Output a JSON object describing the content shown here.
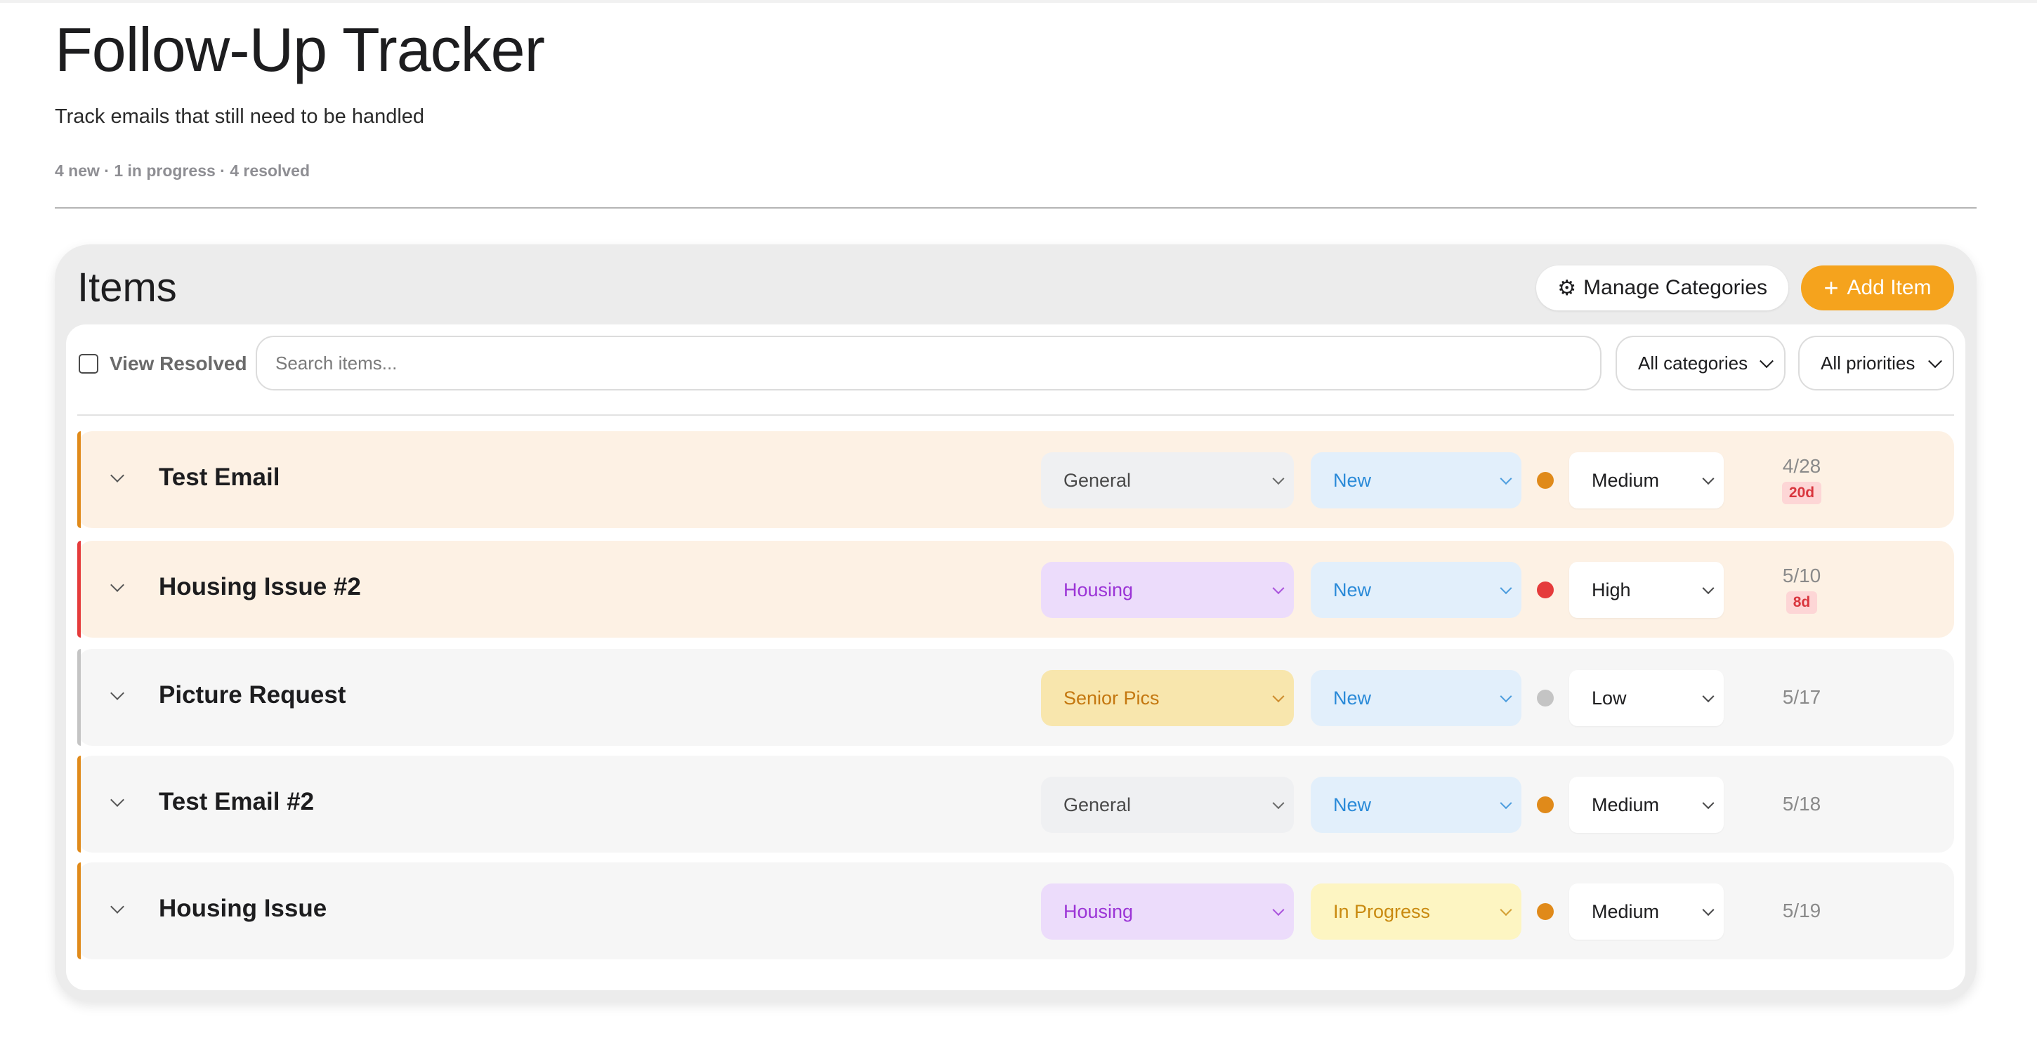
{
  "header": {
    "title": "Follow-Up Tracker",
    "subtitle": "Track emails that still need to be handled",
    "summary": "4 new · 1 in progress · 4 resolved"
  },
  "panel": {
    "title": "Items",
    "manage_label": "Manage Categories",
    "manage_icon": "⚙",
    "add_label": "Add Item",
    "add_icon": "+"
  },
  "filters": {
    "view_resolved_label": "View Resolved",
    "view_resolved_checked": false,
    "search_placeholder": "Search items...",
    "category": "All categories",
    "priority": "All priorities"
  },
  "colors": {
    "accent": "#f5a31d",
    "priority_medium": "#e08a1a",
    "priority_high": "#e53b3b",
    "priority_low": "#c4c4c4",
    "row_alert_bg": "#fdf1e4",
    "row_normal_bg": "#f6f6f6"
  },
  "items": [
    {
      "title": "Test Email",
      "category": "General",
      "status": "New",
      "priority": "Medium",
      "date": "4/28",
      "age": "20d"
    },
    {
      "title": "Housing Issue #2",
      "category": "Housing",
      "status": "New",
      "priority": "High",
      "date": "5/10",
      "age": "8d"
    },
    {
      "title": "Picture Request",
      "category": "Senior Pics",
      "status": "New",
      "priority": "Low",
      "date": "5/17",
      "age": ""
    },
    {
      "title": "Test Email #2",
      "category": "General",
      "status": "New",
      "priority": "Medium",
      "date": "5/18",
      "age": ""
    },
    {
      "title": "Housing Issue",
      "category": "Housing",
      "status": "In Progress",
      "priority": "Medium",
      "date": "5/19",
      "age": ""
    }
  ]
}
